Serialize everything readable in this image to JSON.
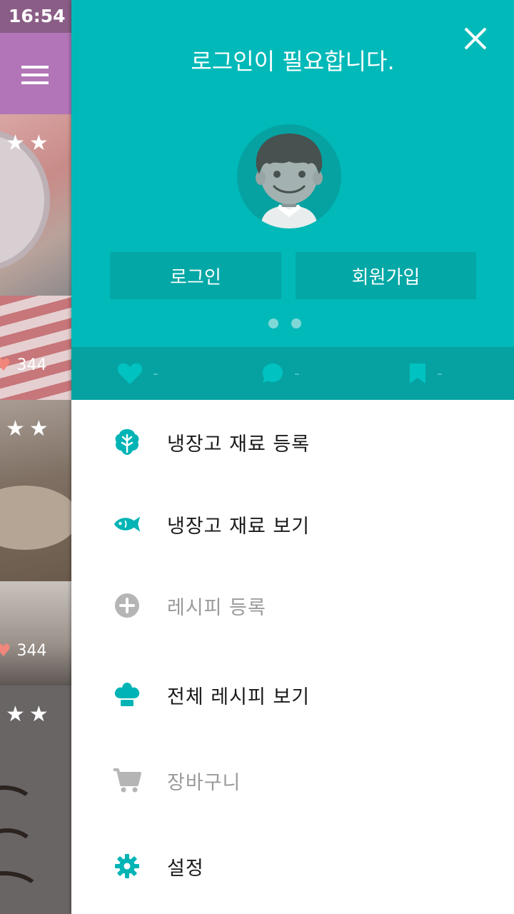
{
  "status_bar": {
    "time": "16:54"
  },
  "background": {
    "cards": [
      {
        "rating_stars": "★★",
        "likes": "344"
      },
      {
        "rating_stars": "★★",
        "likes": "344"
      },
      {
        "rating_stars": "★★"
      }
    ]
  },
  "drawer": {
    "title": "로그인이 필요합니다.",
    "login_label": "로그인",
    "signup_label": "회원가입",
    "page_indicator": {
      "count": 2,
      "active": 0
    },
    "stats": {
      "likes": "-",
      "comments": "-",
      "bookmarks": "-"
    },
    "menu": [
      {
        "label": "냉장고 재료 등록",
        "icon": "lettuce-icon",
        "enabled": true
      },
      {
        "label": "냉장고 재료 보기",
        "icon": "fish-icon",
        "enabled": true
      },
      {
        "label": "레시피 등록",
        "icon": "plus-circle-icon",
        "enabled": false
      },
      {
        "label": "전체 레시피 보기",
        "icon": "chef-hat-icon",
        "enabled": true
      },
      {
        "label": "장바구니",
        "icon": "cart-icon",
        "enabled": false
      },
      {
        "label": "설정",
        "icon": "gear-icon",
        "enabled": true
      }
    ]
  },
  "colors": {
    "drawer_header": "#00b9b8",
    "stats_bar": "#06a2a1",
    "accent_icon": "#00b4b5",
    "disabled": "#9a9a9a",
    "app_bar": "#b276b8"
  }
}
